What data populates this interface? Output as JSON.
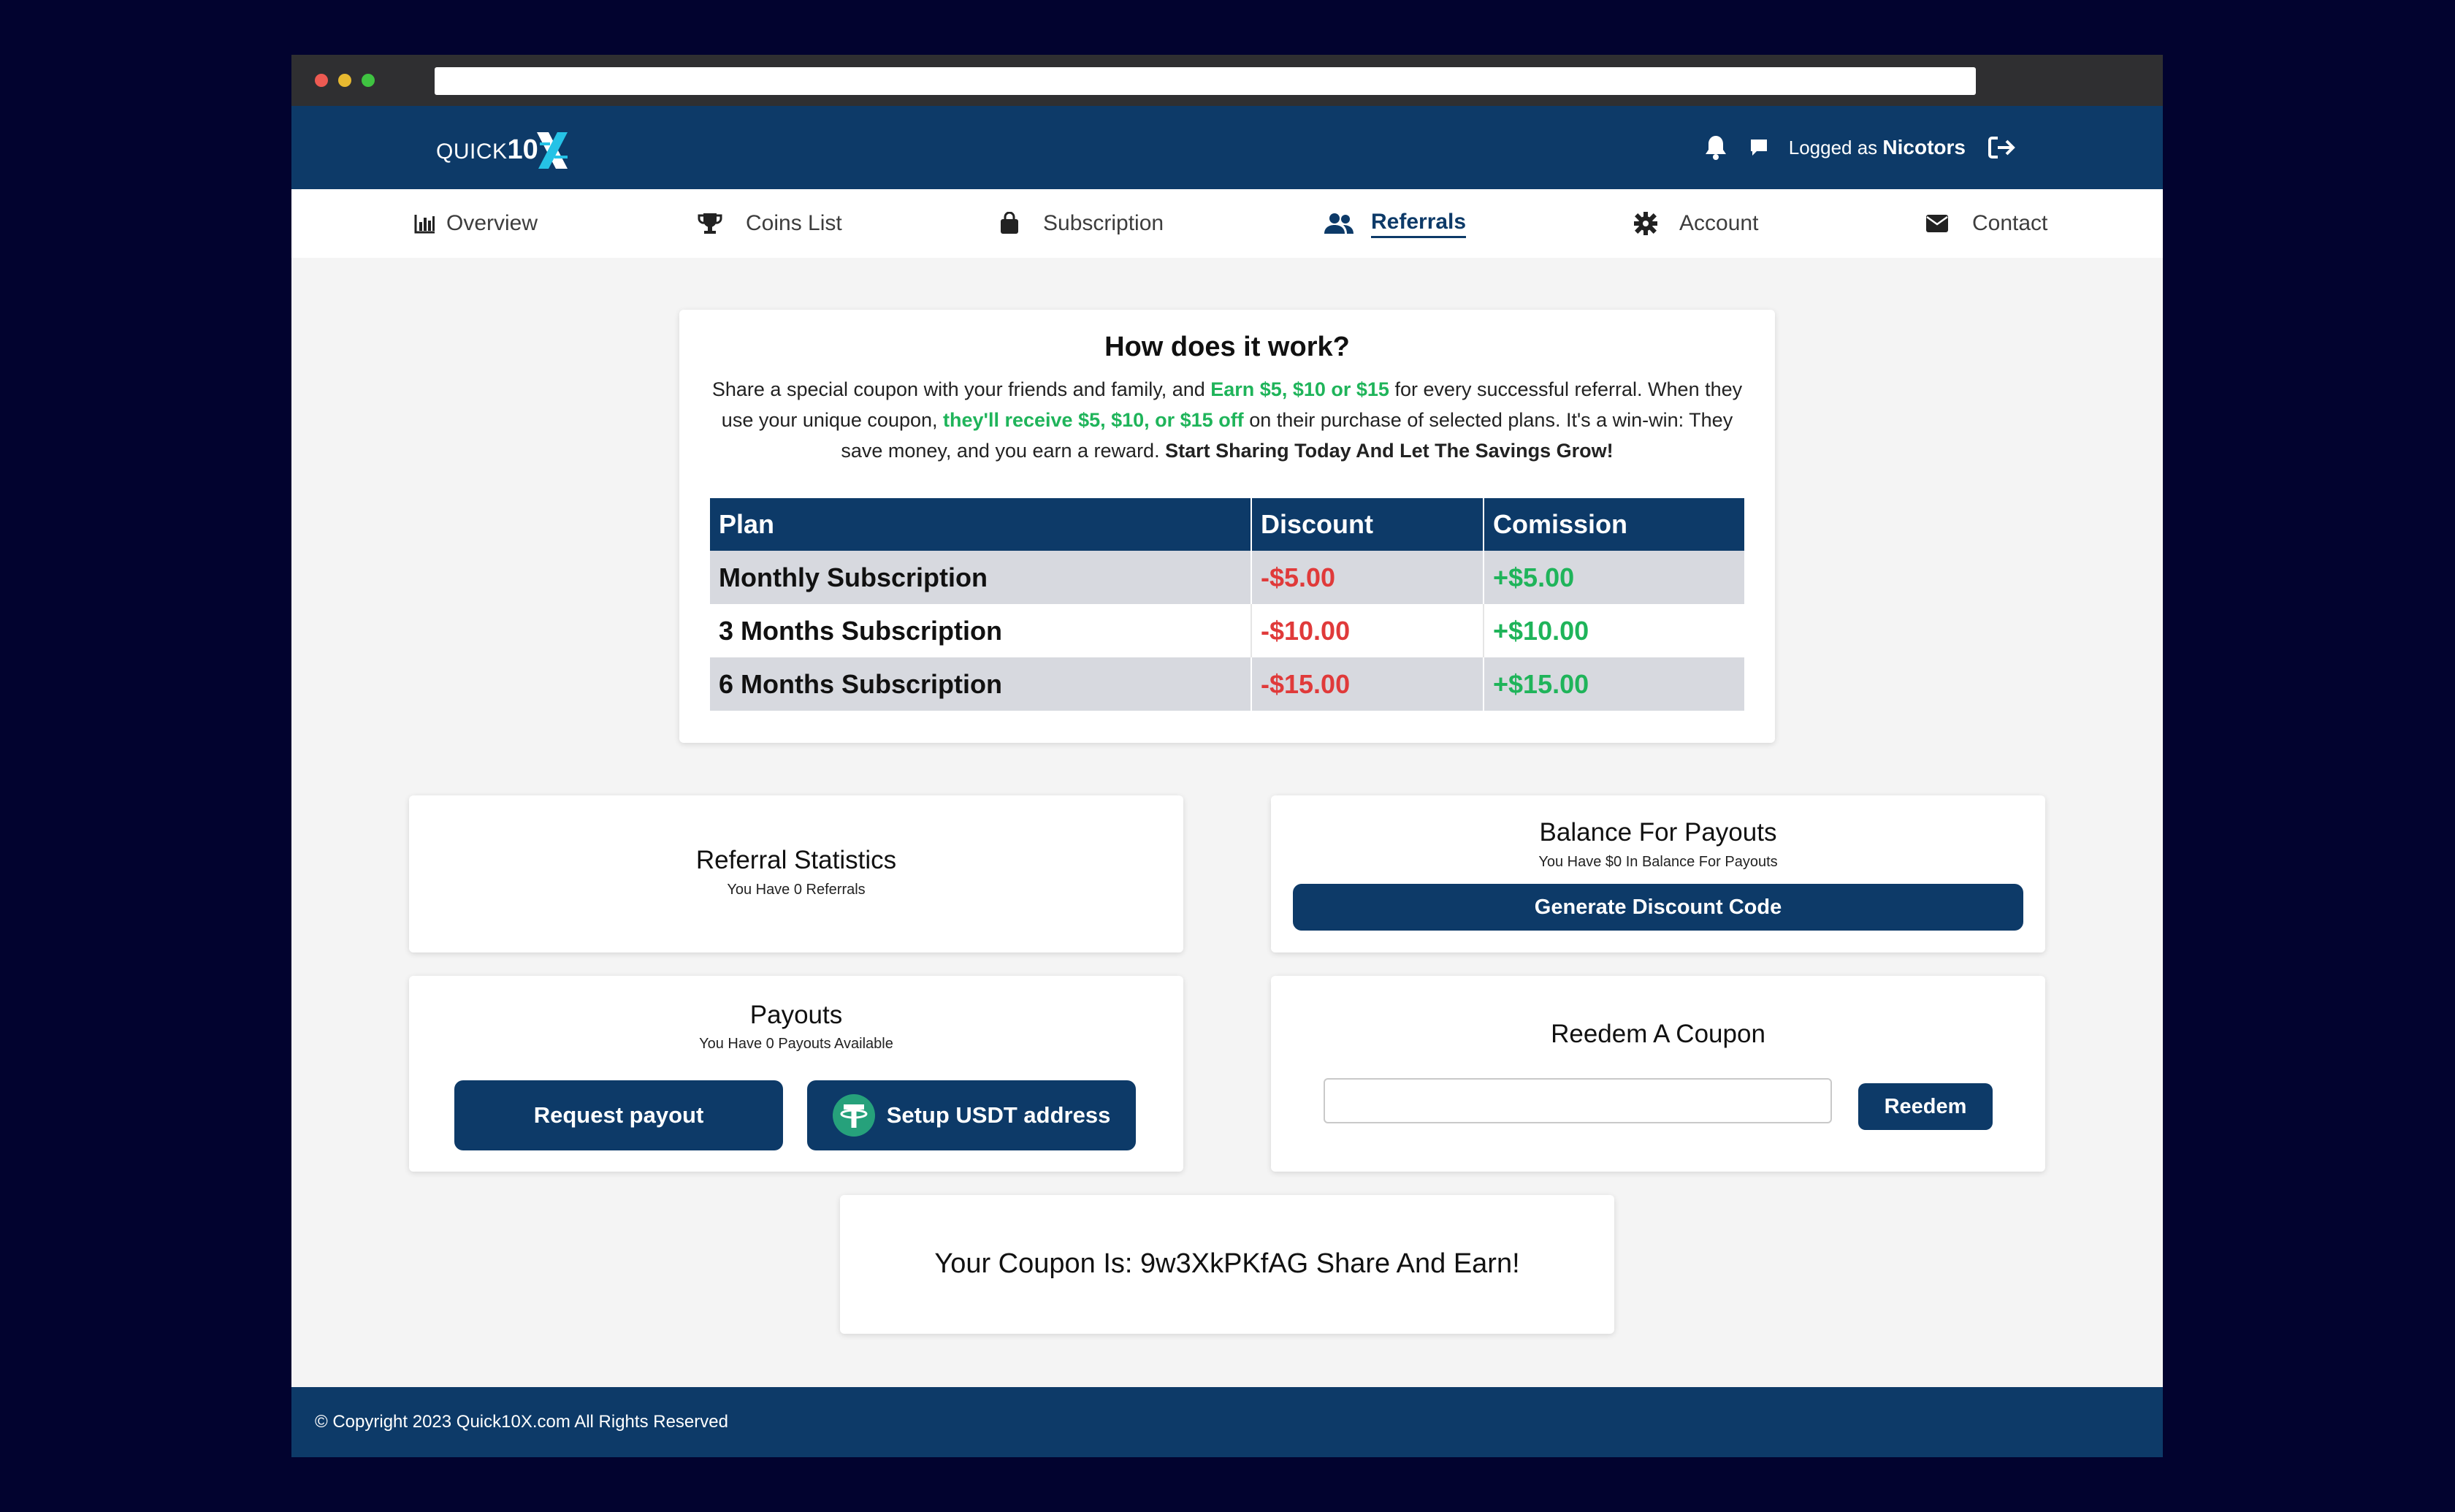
{
  "header": {
    "logo_text": "QUICK",
    "logo_num": "10",
    "logged_prefix": "Logged as",
    "username": "Nicotors"
  },
  "nav": {
    "items": [
      {
        "label": "Overview",
        "icon": "bar-chart-icon"
      },
      {
        "label": "Coins List",
        "icon": "trophy-icon"
      },
      {
        "label": "Subscription",
        "icon": "shopping-bag-icon"
      },
      {
        "label": "Referrals",
        "icon": "users-icon",
        "active": true
      },
      {
        "label": "Account",
        "icon": "gear-icon"
      },
      {
        "label": "Contact",
        "icon": "envelope-icon"
      }
    ]
  },
  "how": {
    "title": "How does it work?",
    "p1": "Share a special coupon with your friends and family, and ",
    "p1_green": "Earn $5, $10 or $15",
    "p2": " for every successful referral. When they use your unique coupon, ",
    "p2_green": "they'll receive $5, $10, or $15 off",
    "p3": " on their purchase of selected plans. It's a win-win: They save money, and you earn a reward. ",
    "p3_bold": "Start Sharing Today And Let The Savings Grow!"
  },
  "plans_table": {
    "headers": [
      "Plan",
      "Discount",
      "Comission"
    ],
    "rows": [
      [
        "Monthly Subscription",
        "-$5.00",
        "+$5.00"
      ],
      [
        "3 Months Subscription",
        "-$10.00",
        "+$10.00"
      ],
      [
        "6 Months Subscription",
        "-$15.00",
        "+$15.00"
      ]
    ]
  },
  "referral_stats": {
    "title": "Referral Statistics",
    "sub": "You Have 0 Referrals"
  },
  "balance": {
    "title": "Balance For Payouts",
    "sub": "You Have $0 In Balance For Payouts",
    "button": "Generate Discount Code"
  },
  "payouts": {
    "title": "Payouts",
    "sub": "You Have 0 Payouts Available",
    "request_button": "Request payout",
    "setup_button": "Setup USDT address"
  },
  "redeem": {
    "title": "Reedem A Coupon",
    "input_value": "",
    "button": "Reedem"
  },
  "coupon": {
    "text": "Your Coupon Is: 9w3XkPKfAG Share And Earn!"
  },
  "footer": {
    "text": "© Copyright 2023 Quick10X.com All Rights Reserved"
  },
  "colors": {
    "brand": "#0d3a68",
    "green": "#1fb45a",
    "red": "#e03a3a",
    "tether": "#26a17b"
  }
}
